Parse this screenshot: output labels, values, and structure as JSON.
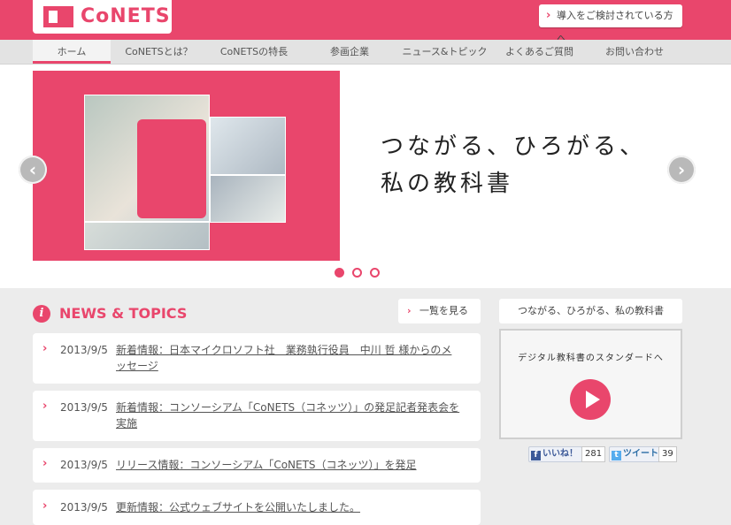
{
  "header": {
    "logo_text": "CoNETS",
    "intro_button": "導入をご検討されている方へ",
    "brand_color": "#e9466c"
  },
  "nav": {
    "items": [
      {
        "label": "ホーム",
        "active": true
      },
      {
        "label": "CoNETSとは？",
        "active": false
      },
      {
        "label": "CoNETSの特長",
        "active": false
      },
      {
        "label": "参画企業",
        "active": false
      },
      {
        "label": "ニュース&トピックス",
        "active": false
      },
      {
        "label": "よくあるご質問",
        "active": false
      },
      {
        "label": "お問い合わせ",
        "active": false
      }
    ]
  },
  "slider": {
    "tagline_line1": "つながる、ひろがる、",
    "tagline_line2": "私の教科書",
    "prev_icon": "‹",
    "next_icon": "›",
    "dots": 3,
    "active_dot": 1
  },
  "news": {
    "title": "NEWS & TOPICS",
    "list_button": "一覧を見る",
    "items": [
      {
        "date": "2013/9/5",
        "text": "新着情報：日本マイクロソフト社　業務執行役員　中川 哲 様からのメッセージ"
      },
      {
        "date": "2013/9/5",
        "text": "新着情報：コンソーシアム「CoNETS（コネッツ）」の発足記者発表会を実施"
      },
      {
        "date": "2013/9/5",
        "text": "リリース情報：コンソーシアム「CoNETS（コネッツ）」を発足"
      },
      {
        "date": "2013/9/5",
        "text": "更新情報：公式ウェブサイトを公開いたしました。"
      }
    ]
  },
  "sidebar": {
    "tagline_button": "つながる、ひろがる、私の教科書",
    "video_caption": "デジタル教科書のスタンダードへ",
    "like_label": "いいね！",
    "like_count": "281",
    "tweet_label": "ツイート",
    "tweet_count": "39"
  }
}
